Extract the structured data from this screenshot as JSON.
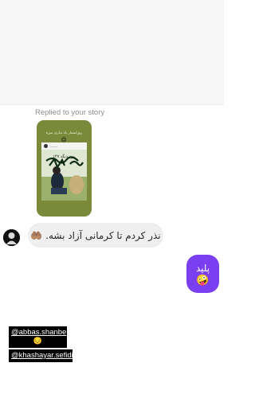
{
  "thread": {
    "replied_label": "Replied to your story",
    "story": {
      "caption": "روزاشمار یاد دیاری میره",
      "caption_emoji": "😔",
      "handwriting": "۱۴۷ روز دیگه",
      "card_color": "#7a8a3a"
    },
    "incoming": {
      "text": "نذر کردم تا کرمانی آزاد بشه. 🤲🏽",
      "bubble_color": "#efefef"
    },
    "outgoing": {
      "text": "پلید",
      "emoji": "🤪",
      "bubble_color": "#7a3ff0"
    }
  },
  "mentions": {
    "first": {
      "handle": "@abbas.shanbe",
      "emoji": "😔"
    },
    "second": {
      "handle": "@khashayar.sefidi"
    }
  }
}
